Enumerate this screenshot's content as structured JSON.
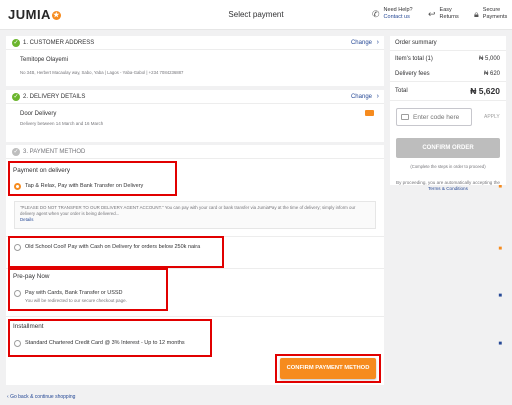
{
  "header": {
    "logo": "JUMIA",
    "logo_star": "★",
    "title": "Select payment",
    "help_line1": "Need Help?",
    "help_line2": "Contact us",
    "returns_line1": "Easy",
    "returns_line2": "Returns",
    "secure_line1": "Secure",
    "secure_line2": "Payments"
  },
  "address": {
    "step": "1. CUSTOMER ADDRESS",
    "change": "Change",
    "name": "Temitope Olayemi",
    "line": "No 34B, Herbert Macaulay way, Sabo, Yaba | Lagos - Yaba-Gabol | +234 7084236887"
  },
  "delivery": {
    "step": "2. DELIVERY DETAILS",
    "change": "Change",
    "method": "Door Delivery",
    "window": "Delivery between 14 March and 16 March"
  },
  "payment": {
    "step": "3. PAYMENT METHOD",
    "group_on_delivery": "Payment on delivery",
    "opt_tap_relax": "Tap & Relax, Pay with Bank Transfer on Delivery",
    "notice": "\"PLEASE DO NOT TRANSFER TO OUR DELIVERY AGENT ACCOUNT.\" You can pay with your card or bank transfer via JumiaPay at the time of delivery; simply inform our delivery agent when your order is being delivered...",
    "notice_link": "Details",
    "opt_cash": "Old School Cool! Pay with Cash on Delivery for orders below 250k naira",
    "group_prepay": "Pre-pay Now",
    "opt_cards": "Pay with Cards, Bank Transfer or USSD",
    "opt_cards_sub": "You will be redirected to our secure checkout page.",
    "group_installment": "Installment",
    "opt_installment": "Standard Chartered Credit Card @ 3% Interest - Up to 12 months",
    "confirm_button": "CONFIRM PAYMENT METHOD"
  },
  "back_link": "Go back & continue shopping",
  "summary": {
    "title": "Order summary",
    "items_label": "Item's total (1)",
    "items_value": "₦ 5,000",
    "fees_label": "Delivery fees",
    "fees_value": "₦ 620",
    "total_label": "Total",
    "total_value": "₦ 5,620",
    "code_placeholder": "Enter code here",
    "apply": "APPLY",
    "confirm_order": "CONFIRM ORDER",
    "complete_note": "(Complete the steps in order to proceed)",
    "terms_text": "By proceeding, you are automatically accepting the",
    "terms_link": "Terms & Conditions"
  },
  "colors": {
    "accent": "#f68b1e",
    "link": "#264996",
    "highlight": "#e10000",
    "check": "#6bb52d"
  }
}
